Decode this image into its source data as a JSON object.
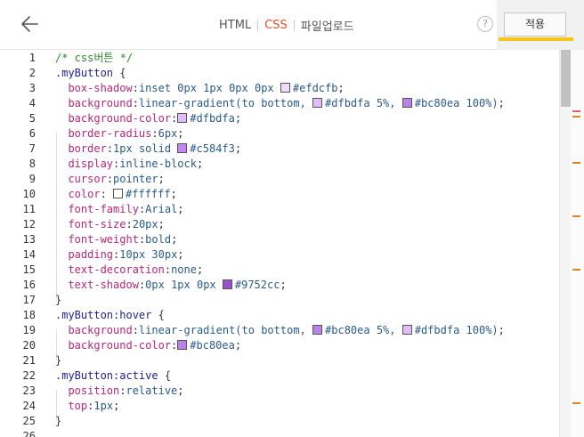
{
  "topbar": {
    "back_icon": "arrow-left-icon",
    "tabs": [
      {
        "label": "HTML",
        "active": false
      },
      {
        "label": "CSS",
        "active": true
      },
      {
        "label": "파일업로드",
        "active": false
      }
    ],
    "help_label": "?",
    "apply_label": "적용"
  },
  "colors": {
    "active_tab": "#e0502d",
    "apply_underline": "#f5c518"
  },
  "editor": {
    "lines": [
      {
        "n": "1",
        "tokens": [
          {
            "t": "/* css버튼 */",
            "c": "c-comment"
          }
        ]
      },
      {
        "n": "2",
        "tokens": [
          {
            "t": ".myButton",
            "c": "c-sel"
          },
          {
            "t": " {",
            "c": "c-brace"
          }
        ]
      },
      {
        "n": "3",
        "tokens": [
          {
            "t": "  "
          },
          {
            "t": "box-shadow",
            "c": "c-prop"
          },
          {
            "t": ":",
            "c": "c-punct"
          },
          {
            "t": "inset 0px 1px 0px 0px ",
            "c": "c-val"
          },
          {
            "sw": "#efdcfb"
          },
          {
            "t": "#efdcfb",
            "c": "c-val"
          },
          {
            "t": ";",
            "c": "c-punct"
          }
        ]
      },
      {
        "n": "4",
        "tokens": [
          {
            "t": "  "
          },
          {
            "t": "background",
            "c": "c-prop"
          },
          {
            "t": ":",
            "c": "c-punct"
          },
          {
            "t": "linear-gradient(to bottom, ",
            "c": "c-val"
          },
          {
            "sw": "#dfbdfa"
          },
          {
            "t": "#dfbdfa 5%, ",
            "c": "c-val"
          },
          {
            "sw": "#bc80ea"
          },
          {
            "t": "#bc80ea 100%)",
            "c": "c-val"
          },
          {
            "t": ";",
            "c": "c-punct"
          }
        ]
      },
      {
        "n": "5",
        "tokens": [
          {
            "t": "  "
          },
          {
            "t": "background-color",
            "c": "c-prop"
          },
          {
            "t": ":",
            "c": "c-punct"
          },
          {
            "sw": "#dfbdfa"
          },
          {
            "t": "#dfbdfa",
            "c": "c-val"
          },
          {
            "t": ";",
            "c": "c-punct"
          }
        ]
      },
      {
        "n": "6",
        "tokens": [
          {
            "t": "  "
          },
          {
            "t": "border-radius",
            "c": "c-prop"
          },
          {
            "t": ":",
            "c": "c-punct"
          },
          {
            "t": "6px",
            "c": "c-val"
          },
          {
            "t": ";",
            "c": "c-punct"
          }
        ]
      },
      {
        "n": "7",
        "tokens": [
          {
            "t": "  "
          },
          {
            "t": "border",
            "c": "c-prop"
          },
          {
            "t": ":",
            "c": "c-punct"
          },
          {
            "t": "1px solid ",
            "c": "c-val"
          },
          {
            "sw": "#c584f3"
          },
          {
            "t": "#c584f3",
            "c": "c-val"
          },
          {
            "t": ";",
            "c": "c-punct"
          }
        ]
      },
      {
        "n": "8",
        "tokens": [
          {
            "t": "  "
          },
          {
            "t": "display",
            "c": "c-prop"
          },
          {
            "t": ":",
            "c": "c-punct"
          },
          {
            "t": "inline-block",
            "c": "c-val"
          },
          {
            "t": ";",
            "c": "c-punct"
          }
        ]
      },
      {
        "n": "9",
        "tokens": [
          {
            "t": "  "
          },
          {
            "t": "cursor",
            "c": "c-prop"
          },
          {
            "t": ":",
            "c": "c-punct"
          },
          {
            "t": "pointer",
            "c": "c-val"
          },
          {
            "t": ";",
            "c": "c-punct"
          }
        ]
      },
      {
        "n": "10",
        "tokens": [
          {
            "t": "  "
          },
          {
            "t": "color",
            "c": "c-prop"
          },
          {
            "t": ": ",
            "c": "c-punct"
          },
          {
            "sw": "#ffffff"
          },
          {
            "t": "#ffffff",
            "c": "c-val"
          },
          {
            "t": ";",
            "c": "c-punct"
          }
        ]
      },
      {
        "n": "11",
        "tokens": [
          {
            "t": "  "
          },
          {
            "t": "font-family",
            "c": "c-prop"
          },
          {
            "t": ":",
            "c": "c-punct"
          },
          {
            "t": "Arial",
            "c": "c-val"
          },
          {
            "t": ";",
            "c": "c-punct"
          }
        ]
      },
      {
        "n": "12",
        "tokens": [
          {
            "t": "  "
          },
          {
            "t": "font-size",
            "c": "c-prop"
          },
          {
            "t": ":",
            "c": "c-punct"
          },
          {
            "t": "20px",
            "c": "c-val"
          },
          {
            "t": ";",
            "c": "c-punct"
          }
        ]
      },
      {
        "n": "13",
        "tokens": [
          {
            "t": "  "
          },
          {
            "t": "font-weight",
            "c": "c-prop"
          },
          {
            "t": ":",
            "c": "c-punct"
          },
          {
            "t": "bold",
            "c": "c-val"
          },
          {
            "t": ";",
            "c": "c-punct"
          }
        ]
      },
      {
        "n": "14",
        "tokens": [
          {
            "t": "  "
          },
          {
            "t": "padding",
            "c": "c-prop"
          },
          {
            "t": ":",
            "c": "c-punct"
          },
          {
            "t": "10px 30px",
            "c": "c-val"
          },
          {
            "t": ";",
            "c": "c-punct"
          }
        ]
      },
      {
        "n": "15",
        "tokens": [
          {
            "t": "  "
          },
          {
            "t": "text-decoration",
            "c": "c-prop"
          },
          {
            "t": ":",
            "c": "c-punct"
          },
          {
            "t": "none",
            "c": "c-val"
          },
          {
            "t": ";",
            "c": "c-punct"
          }
        ]
      },
      {
        "n": "16",
        "tokens": [
          {
            "t": "  "
          },
          {
            "t": "text-shadow",
            "c": "c-prop"
          },
          {
            "t": ":",
            "c": "c-punct"
          },
          {
            "t": "0px 1px 0px ",
            "c": "c-val"
          },
          {
            "sw": "#9752cc"
          },
          {
            "t": "#9752cc",
            "c": "c-val"
          },
          {
            "t": ";",
            "c": "c-punct"
          }
        ]
      },
      {
        "n": "17",
        "tokens": [
          {
            "t": "}",
            "c": "c-brace"
          }
        ]
      },
      {
        "n": "18",
        "tokens": [
          {
            "t": ".myButton:hover",
            "c": "c-sel"
          },
          {
            "t": " {",
            "c": "c-brace"
          }
        ]
      },
      {
        "n": "19",
        "tokens": [
          {
            "t": "  "
          },
          {
            "t": "background",
            "c": "c-prop"
          },
          {
            "t": ":",
            "c": "c-punct"
          },
          {
            "t": "linear-gradient(to bottom, ",
            "c": "c-val"
          },
          {
            "sw": "#bc80ea"
          },
          {
            "t": "#bc80ea 5%, ",
            "c": "c-val"
          },
          {
            "sw": "#dfbdfa"
          },
          {
            "t": "#dfbdfa 100%)",
            "c": "c-val"
          },
          {
            "t": ";",
            "c": "c-punct"
          }
        ]
      },
      {
        "n": "20",
        "tokens": [
          {
            "t": "  "
          },
          {
            "t": "background-color",
            "c": "c-prop"
          },
          {
            "t": ":",
            "c": "c-punct"
          },
          {
            "sw": "#bc80ea"
          },
          {
            "t": "#bc80ea",
            "c": "c-val"
          },
          {
            "t": ";",
            "c": "c-punct"
          }
        ]
      },
      {
        "n": "21",
        "tokens": [
          {
            "t": "}",
            "c": "c-brace"
          }
        ]
      },
      {
        "n": "22",
        "tokens": [
          {
            "t": ".myButton:active",
            "c": "c-sel"
          },
          {
            "t": " {",
            "c": "c-brace"
          }
        ]
      },
      {
        "n": "23",
        "tokens": [
          {
            "t": "  "
          },
          {
            "t": "position",
            "c": "c-prop"
          },
          {
            "t": ":",
            "c": "c-punct"
          },
          {
            "t": "relative",
            "c": "c-val"
          },
          {
            "t": ";",
            "c": "c-punct"
          }
        ]
      },
      {
        "n": "24",
        "tokens": [
          {
            "t": "  "
          },
          {
            "t": "top",
            "c": "c-prop"
          },
          {
            "t": ":",
            "c": "c-punct"
          },
          {
            "t": "1px",
            "c": "c-val"
          },
          {
            "t": ";",
            "c": "c-punct"
          }
        ]
      },
      {
        "n": "25",
        "tokens": [
          {
            "t": "}",
            "c": "c-brace"
          }
        ]
      },
      {
        "n": "26",
        "tokens": []
      }
    ]
  },
  "overview_marks": [
    {
      "color": "#e06060"
    },
    {
      "color": "#d08a2a"
    },
    {
      "color": "#d08a2a"
    },
    {
      "color": "#d08a2a"
    },
    {
      "color": "#d08a2a"
    },
    {
      "color": "#d08a2a"
    }
  ]
}
